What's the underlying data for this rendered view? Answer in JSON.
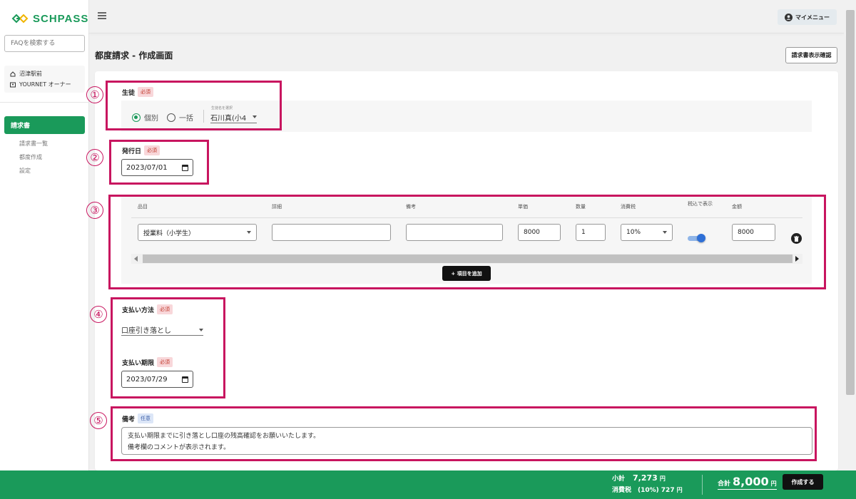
{
  "sidebar": {
    "logo": "SCHPASS",
    "faq_placeholder": "FAQを検索する",
    "org": {
      "school": "沼津駅前",
      "owner": "YOURNET オーナー"
    },
    "nav_active": "請求書",
    "nav_items": [
      "請求書一覧",
      "都度作成",
      "設定"
    ]
  },
  "header": {
    "my_menu": "マイメニュー"
  },
  "page": {
    "title": "都度請求 - 作成画面",
    "preview_button": "請求書表示確認"
  },
  "form": {
    "student": {
      "label": "生徒",
      "required": "必須",
      "radio_individual": "個別",
      "radio_bulk": "一括",
      "select_label": "生徒名を選択",
      "select_value": "石川真(小4"
    },
    "issue_date": {
      "label": "発行日",
      "required": "必須",
      "value": "2023/07/01"
    },
    "items": {
      "headers": [
        "品目",
        "詳細",
        "備考",
        "単価",
        "数量",
        "消費税",
        "税込で表示",
        "金額"
      ],
      "row": {
        "item": "授業料（小学生）",
        "detail": "",
        "note": "",
        "unit_price": "8000",
        "quantity": "1",
        "tax": "10%",
        "tax_inclusive": true,
        "amount": "8000"
      },
      "add_button": "+ 項目を追加"
    },
    "payment_method": {
      "label": "支払い方法",
      "required": "必須",
      "value": "口座引き落とし"
    },
    "payment_due": {
      "label": "支払い期限",
      "required": "必須",
      "value": "2023/07/29"
    },
    "remarks": {
      "label": "備考",
      "optional": "任意",
      "line1": "支払い期限までに引き落とし口座の残高確認をお願いいたします。",
      "line2": "備考欄のコメントが表示されます。"
    }
  },
  "annotations": [
    "①",
    "②",
    "③",
    "④",
    "⑤"
  ],
  "footer": {
    "subtotal_label": "小計",
    "subtotal_value": "7,273",
    "yen": "円",
    "tax_label": "消費税",
    "tax_rate": "(10%)",
    "tax_value": "727",
    "total_label": "合計",
    "total_value": "8,000",
    "create_button": "作成する"
  },
  "colors": {
    "brand": "#1a9a5a",
    "annotation": "#c8155f",
    "required_bg": "#f8d7da"
  }
}
